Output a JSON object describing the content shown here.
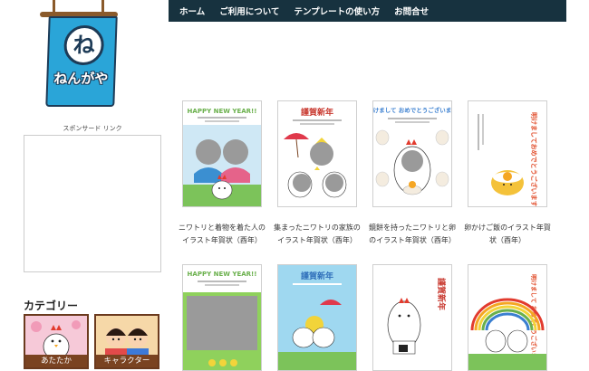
{
  "logo": {
    "mark": "ね",
    "name": "ねんがや"
  },
  "nav": {
    "items": [
      "ホーム",
      "ご利用について",
      "テンプレートの使い方",
      "お問合せ"
    ]
  },
  "sidebar": {
    "sponsor_label": "スポンサード リンク",
    "category_heading": "カテゴリー",
    "categories": [
      {
        "label": "あたたか",
        "icon": "chicken-illustration"
      },
      {
        "label": "キャラクター",
        "icon": "children-illustration"
      }
    ]
  },
  "cards": [
    {
      "header": "HAPPY NEW YEAR!!",
      "caption": "ニワトリと着物を着た人のイラスト年賀状（酉年）"
    },
    {
      "header": "謹賀新年",
      "caption": "集まったニワトリの家族のイラスト年賀状（酉年）"
    },
    {
      "header": "明けまして おめでとうございます",
      "caption": "鏡餅を持ったニワトリと卵のイラスト年賀状（酉年）"
    },
    {
      "header": "明けましておめでとうございます",
      "caption": "卵かけご飯のイラスト年賀状（酉年）"
    },
    {
      "header": "HAPPY NEW YEAR!!",
      "caption": ""
    },
    {
      "header": "謹賀新年",
      "caption": ""
    },
    {
      "header": "謹賀新年",
      "caption": ""
    },
    {
      "header": "明けまして おめでとうございます",
      "caption": ""
    }
  ],
  "colors": {
    "nav_bg": "#17323f",
    "logo_blue": "#2aa5d8",
    "category_bar": "#7a4321"
  }
}
